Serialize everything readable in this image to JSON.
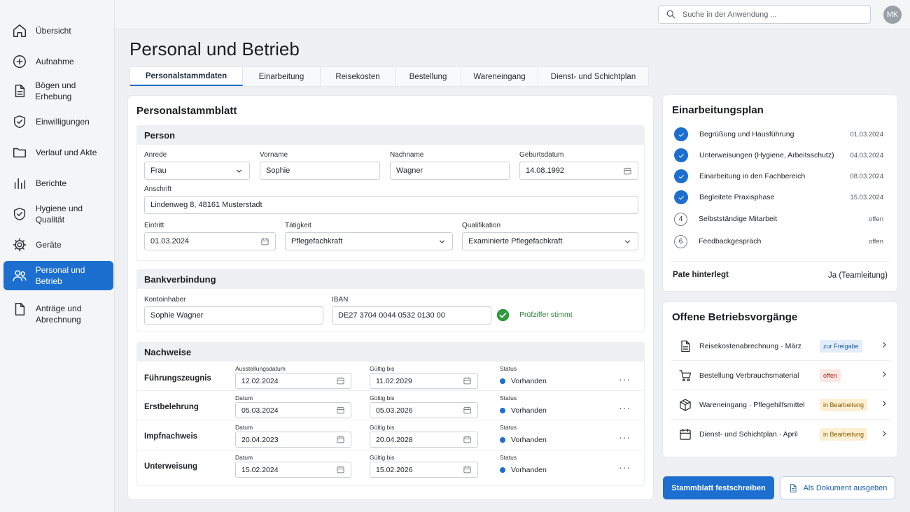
{
  "app": {
    "search_placeholder": "Suche in der Anwendung ...",
    "user_initials": "MK",
    "accent_color": "#1d6fcf"
  },
  "sidebar": {
    "items": [
      {
        "label": "Übersicht",
        "icon": "home-icon"
      },
      {
        "label": "Aufnahme",
        "icon": "plus-circle-icon"
      },
      {
        "label": "Bögen und Erhebung",
        "icon": "document-icon"
      },
      {
        "label": "Einwilligungen",
        "icon": "shield-check-icon"
      },
      {
        "label": "Verlauf und Akte",
        "icon": "folder-icon"
      },
      {
        "label": "Berichte",
        "icon": "bar-chart-icon"
      },
      {
        "label": "Hygiene und Qualität",
        "icon": "shield-check-icon"
      },
      {
        "label": "Geräte",
        "icon": "gear-icon"
      },
      {
        "label": "Personal und Betrieb",
        "icon": "users-icon",
        "active": true
      },
      {
        "label": "Anträge und Abrechnung",
        "icon": "document-icon"
      }
    ]
  },
  "page": {
    "title": "Personal und Betrieb"
  },
  "tabs": [
    {
      "label": "Personalstammdaten",
      "active": true
    },
    {
      "label": "Einarbeitung"
    },
    {
      "label": "Reisekosten"
    },
    {
      "label": "Bestellung"
    },
    {
      "label": "Wareneingang"
    },
    {
      "label": "Dienst- und Schichtplan"
    }
  ],
  "stammblatt": {
    "title": "Personalstammblatt",
    "person": {
      "heading": "Person",
      "anrede_label": "Anrede",
      "anrede_value": "Frau",
      "vorname_label": "Vorname",
      "vorname_value": "Sophie",
      "nachname_label": "Nachname",
      "nachname_value": "Wagner",
      "geburtsdatum_label": "Geburtsdatum",
      "geburtsdatum_value": "14.08.1992",
      "anschrift_label": "Anschrift",
      "anschrift_value": "Lindenweg 8, 48161 Musterstadt",
      "eintritt_label": "Eintritt",
      "eintritt_value": "01.03.2024",
      "taetigkeit_label": "Tätigkeit",
      "taetigkeit_value": "Pflegefachkraft",
      "qualifikation_label": "Qualifikation",
      "qualifikation_value": "Examinierte Pflegefachkraft"
    },
    "bank": {
      "heading": "Bankverbindung",
      "inhaber_label": "Kontoinhaber",
      "inhaber_value": "Sophie Wagner",
      "iban_label": "IBAN",
      "iban_value": "DE27 3704 0044 0532 0130 00",
      "check_text": "Prüfziffer stimmt"
    },
    "nachweise": {
      "heading": "Nachweise",
      "rows": [
        {
          "name": "Führungszeugnis",
          "date_label": "Ausstellungsdatum",
          "date_value": "12.02.2024",
          "valid_label": "Gültig bis",
          "valid_value": "11.02.2029",
          "status_label": "Status",
          "status_value": "Vorhanden"
        },
        {
          "name": "Erstbelehrung",
          "date_label": "Datum",
          "date_value": "05.03.2024",
          "valid_label": "Gültig bis",
          "valid_value": "05.03.2026",
          "status_label": "Status",
          "status_value": "Vorhanden"
        },
        {
          "name": "Impfnachweis",
          "date_label": "Datum",
          "date_value": "20.04.2023",
          "valid_label": "Gültig bis",
          "valid_value": "20.04.2028",
          "status_label": "Status",
          "status_value": "Vorhanden"
        },
        {
          "name": "Unterweisung",
          "date_label": "Datum",
          "date_value": "15.02.2024",
          "valid_label": "Gültig bis",
          "valid_value": "15.02.2026",
          "status_label": "Status",
          "status_value": "Vorhanden"
        }
      ]
    }
  },
  "einarbeitungsplan": {
    "title": "Einarbeitungsplan",
    "steps": [
      {
        "marker": "check",
        "text": "Begrüßung und Hausführung",
        "date": "01.03.2024"
      },
      {
        "marker": "check",
        "text": "Unterweisungen (Hygiene, Arbeitsschutz)",
        "date": "04.03.2024"
      },
      {
        "marker": "check",
        "text": "Einarbeitung in den Fachbereich",
        "date": "08.03.2024"
      },
      {
        "marker": "check",
        "text": "Begleitete Praxisphase",
        "date": "15.03.2024"
      },
      {
        "marker": "4",
        "text": "Selbstständige Mitarbeit",
        "date": "offen"
      },
      {
        "marker": "6",
        "text": "Feedbackgespräch",
        "date": "offen"
      }
    ],
    "pate_label": "Pate hinterlegt",
    "pate_value": "Ja (Teamleitung)"
  },
  "vorgaenge": {
    "title": "Offene Betriebsvorgänge",
    "items": [
      {
        "icon": "document-icon",
        "text": "Reisekostenabrechnung · März",
        "badge": "zur Freigabe",
        "badge_color": "blue"
      },
      {
        "icon": "cart-icon",
        "text": "Bestellung Verbrauchsmaterial",
        "badge": "offen",
        "badge_color": "red"
      },
      {
        "icon": "box-icon",
        "text": "Wareneingang · Pflegehilfsmittel",
        "badge": "in Bearbeitung",
        "badge_color": "orange"
      },
      {
        "icon": "calendar-icon",
        "text": "Dienst- und Schichtplan · April",
        "badge": "in Bearbeitung",
        "badge_color": "orange"
      }
    ]
  },
  "actions": {
    "primary": "Stammblatt festschreiben",
    "secondary": "Als Dokument ausgeben"
  }
}
